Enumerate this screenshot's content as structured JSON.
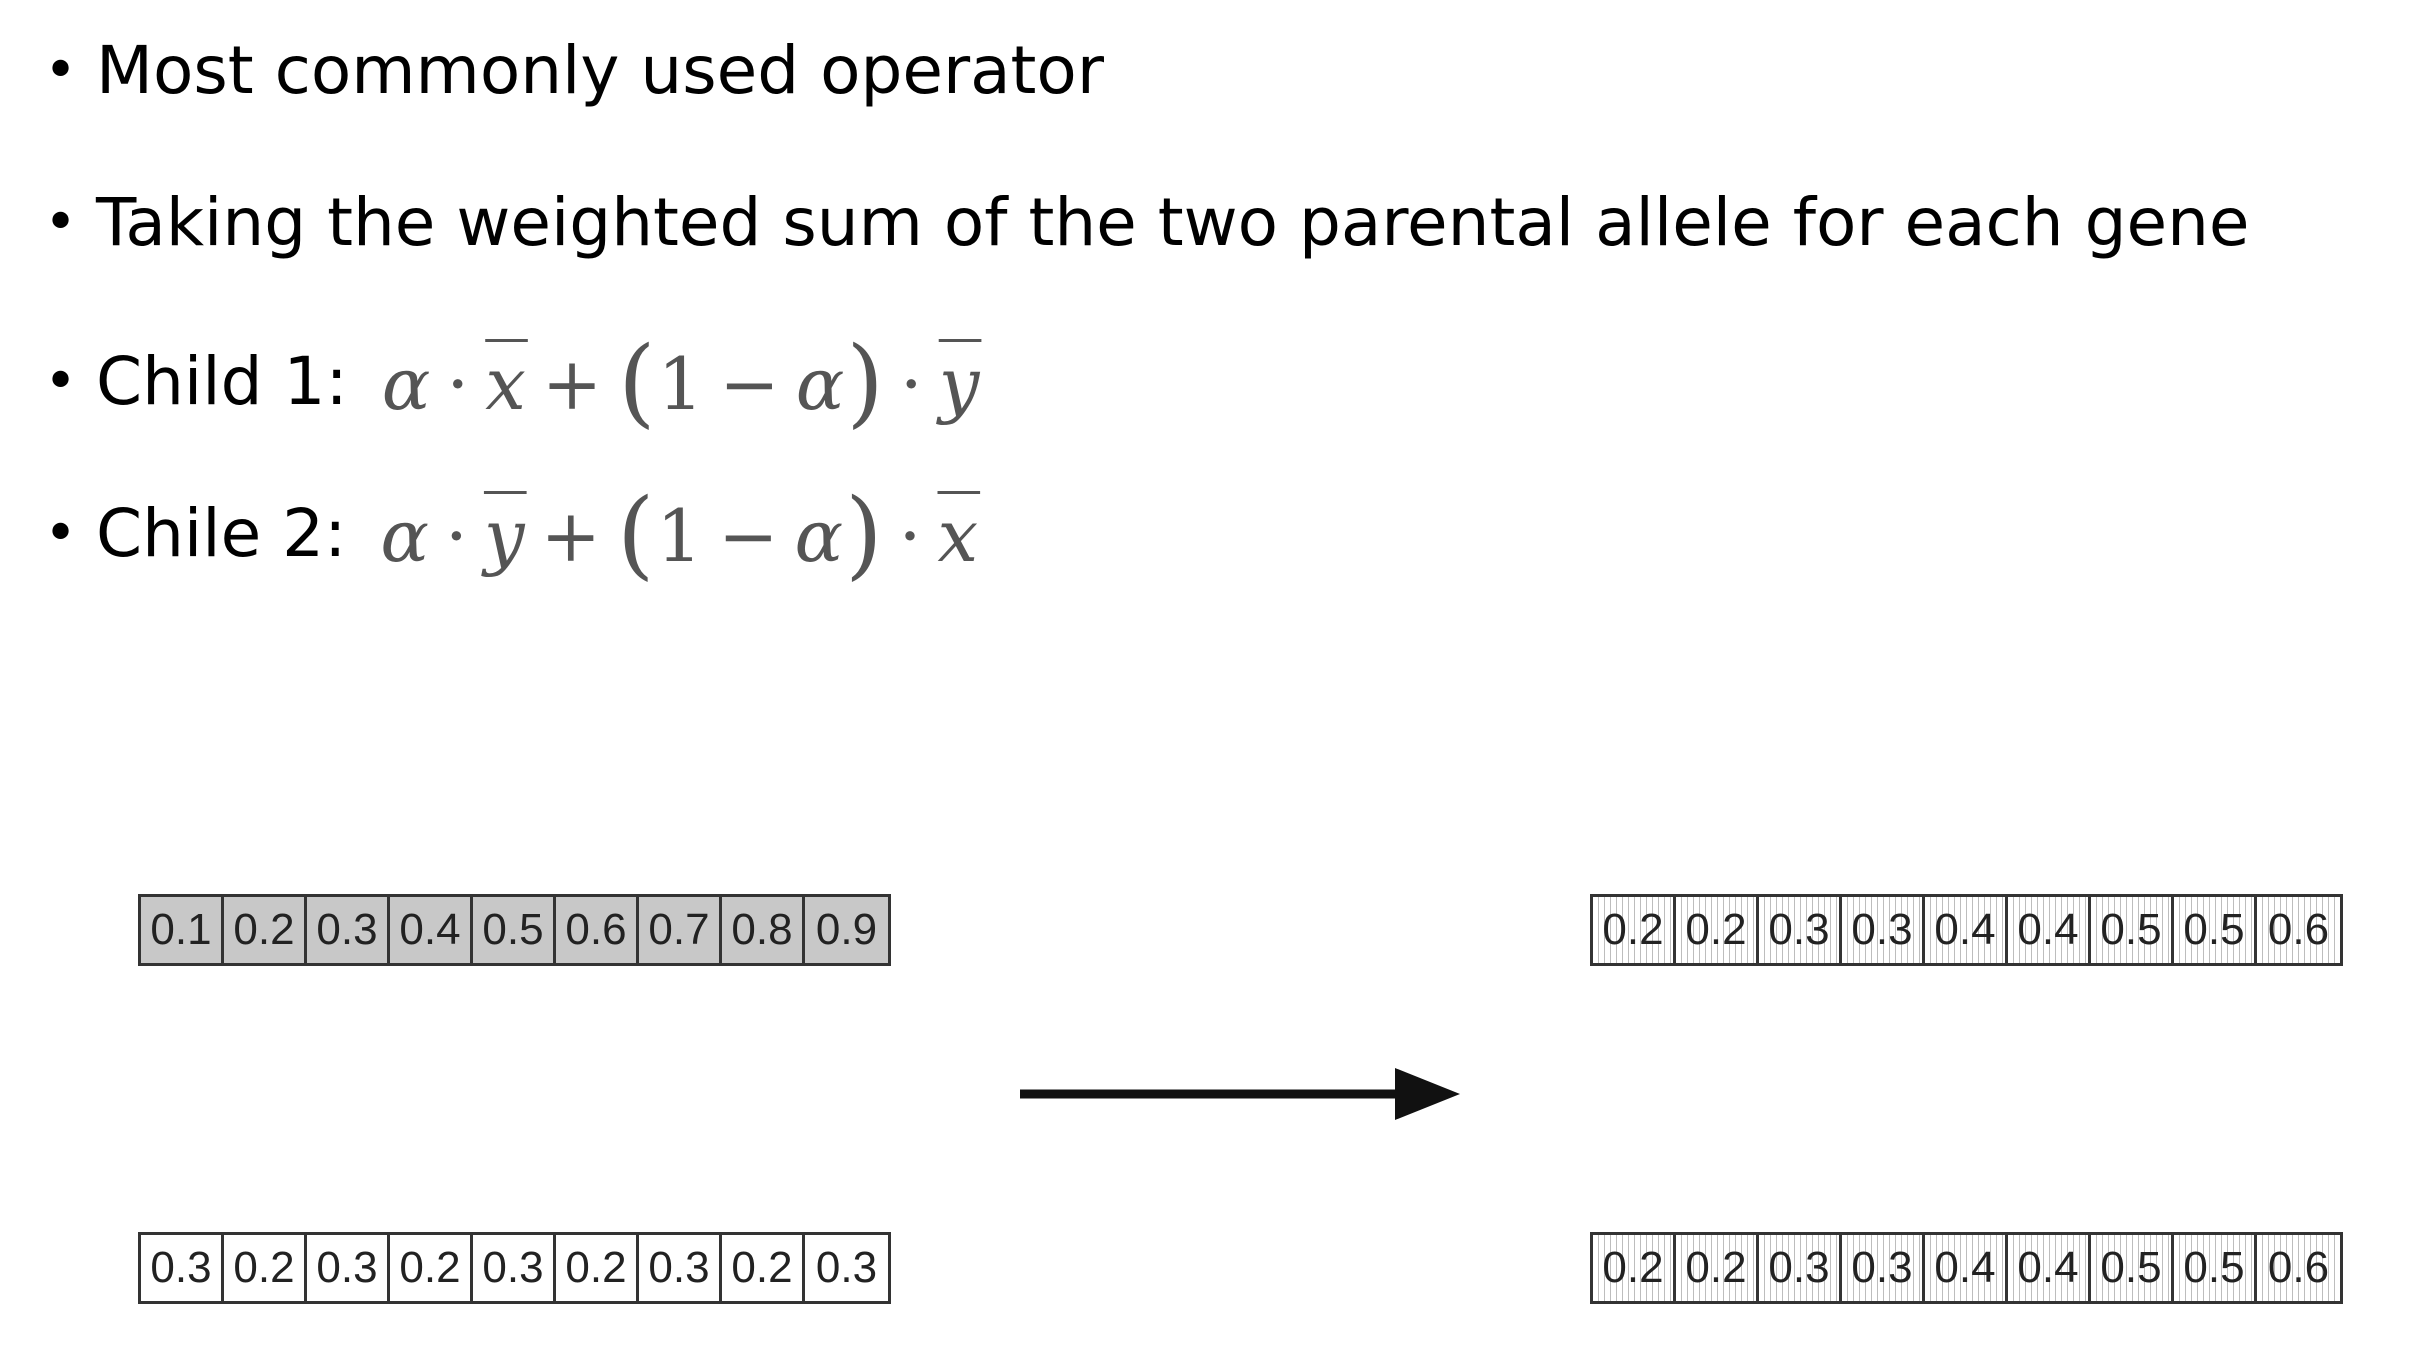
{
  "bullets": [
    {
      "label": "Most commonly used operator"
    },
    {
      "label": "Taking the weighted sum of the two parental allele for each gene"
    },
    {
      "label": "Child 1:"
    },
    {
      "label": "Chile 2:"
    }
  ],
  "formulas": {
    "child1": {
      "alpha": "α",
      "dot": "·",
      "first": "x",
      "plus": "+",
      "lparen": "(",
      "one": "1",
      "minus": "−",
      "rparen": ")",
      "second": "y"
    },
    "child2": {
      "alpha": "α",
      "dot": "·",
      "first": "y",
      "plus": "+",
      "lparen": "(",
      "one": "1",
      "minus": "−",
      "rparen": ")",
      "second": "x"
    }
  },
  "chromosomes": {
    "parent1": [
      "0.1",
      "0.2",
      "0.3",
      "0.4",
      "0.5",
      "0.6",
      "0.7",
      "0.8",
      "0.9"
    ],
    "parent2": [
      "0.3",
      "0.2",
      "0.3",
      "0.2",
      "0.3",
      "0.2",
      "0.3",
      "0.2",
      "0.3"
    ],
    "child1": [
      "0.2",
      "0.2",
      "0.3",
      "0.3",
      "0.4",
      "0.4",
      "0.5",
      "0.5",
      "0.6"
    ],
    "child2": [
      "0.2",
      "0.2",
      "0.3",
      "0.3",
      "0.4",
      "0.4",
      "0.5",
      "0.5",
      "0.6"
    ]
  },
  "colors": {
    "parent1_fill": "#c8c8c8",
    "parent2_fill": "#ffffff",
    "border": "#333333",
    "arrow": "#111111",
    "formula": "#555555"
  },
  "icons": {
    "arrow": "right-arrow-icon"
  }
}
